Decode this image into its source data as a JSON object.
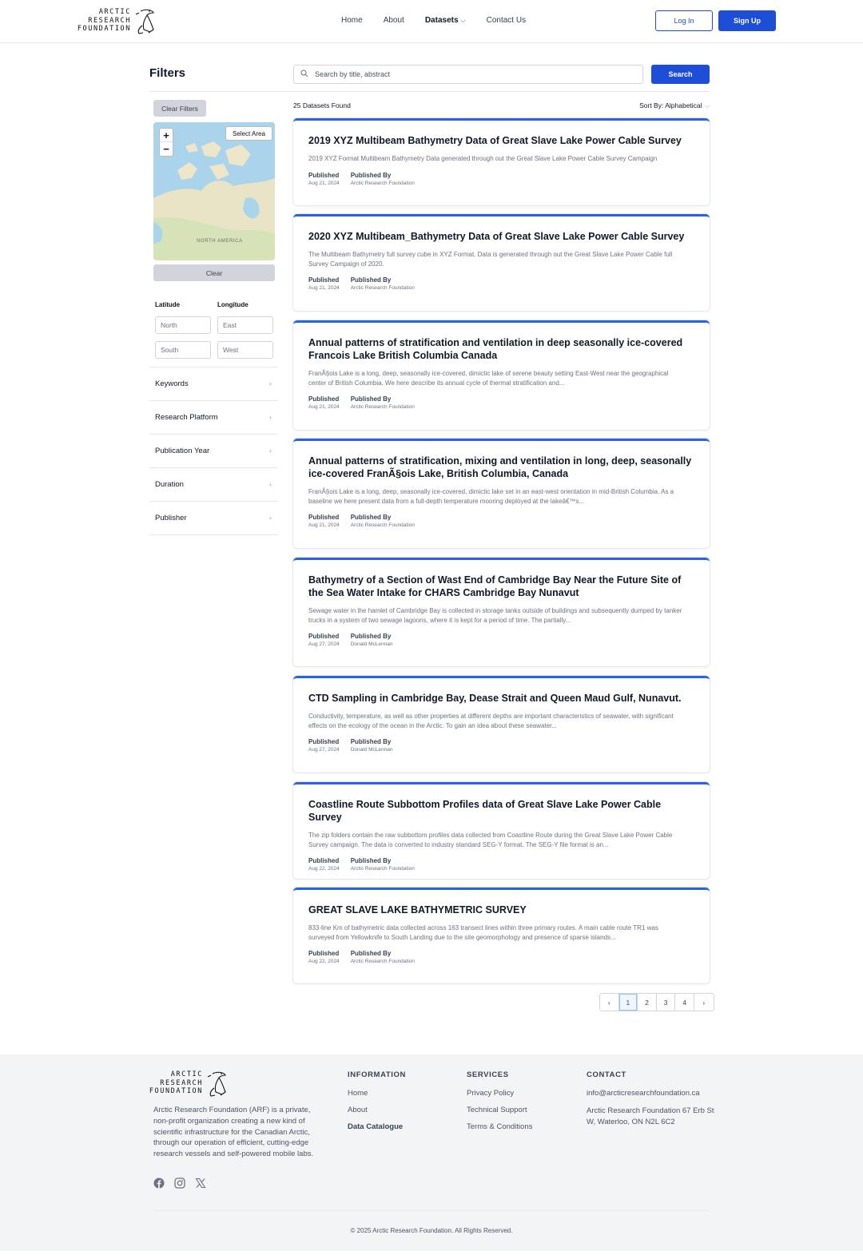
{
  "header": {
    "logo_lines": [
      "ARCTIC",
      "RESEARCH",
      "FOUNDATION"
    ],
    "nav": [
      {
        "label": "Home",
        "active": false
      },
      {
        "label": "About",
        "active": false
      },
      {
        "label": "Datasets",
        "active": true,
        "has_dropdown": true
      },
      {
        "label": "Contact Us",
        "active": false
      }
    ],
    "login_label": "Log In",
    "signup_label": "Sign Up"
  },
  "sidebar": {
    "title": "Filters",
    "clear_filters_label": "Clear Filters",
    "map": {
      "zoom_in": "+",
      "zoom_out": "−",
      "select_area_label": "Select Area",
      "region_label": "NORTH AMERICA",
      "clear_label": "Clear"
    },
    "latitude_label": "Latitude",
    "longitude_label": "Longitude",
    "north_placeholder": "North",
    "east_placeholder": "East",
    "south_placeholder": "South",
    "west_placeholder": "West",
    "accordions": [
      {
        "label": "Keywords",
        "icon": "+"
      },
      {
        "label": "Research Platform",
        "icon": "+"
      },
      {
        "label": "Publication Year",
        "icon": "+"
      },
      {
        "label": "Duration",
        "icon": "+"
      },
      {
        "label": "Publisher",
        "icon": "+"
      }
    ]
  },
  "main": {
    "search_placeholder": "Search by title, abstract",
    "search_button": "Search",
    "results_count": "25 Datasets Found",
    "sort_label": "Sort By: Alphabetical",
    "published_label": "Published",
    "published_by_label": "Published By",
    "datasets": [
      {
        "title": "2019 XYZ Multibeam Bathymetry Data of Great Slave Lake Power Cable Survey",
        "abstract": "2019 XYZ Format Multibeam Bathymetry Data generated through out the Great Slave Lake Power Cable Survey Campaign",
        "published": "Aug 21, 2024",
        "publisher": "Arctic Research Foundation"
      },
      {
        "title": "2020 XYZ Multibeam_Bathymetry Data of Great Slave Lake Power Cable Survey",
        "abstract": "The Multibeam Bathymetry full survey cube in XYZ Format. Data is generated through out the Great Slave Lake Power Cable full Survey Campaign of 2020.",
        "published": "Aug 21, 2024",
        "publisher": "Arctic Research Foundation"
      },
      {
        "title": "Annual patterns of stratification and ventilation in deep seasonally ice-covered Francois Lake British Columbia Canada",
        "abstract": "FranÃ§ois Lake is a long, deep, seasonally ice-covered, dimictic lake of serene beauty setting East-West near the geographical center of British Columbia. We here describe its annual cycle of thermal stratification and...",
        "published": "Aug 21, 2024",
        "publisher": "Arctic Research Foundation"
      },
      {
        "title": "Annual patterns of stratification, mixing and ventilation in long, deep, seasonally ice-covered FranÃ§ois Lake, British Columbia, Canada",
        "abstract": "FranÃ§ois Lake is a long, deep, seasonally ice-covered, dimictic lake set in an east-west orientation in mid-British Columbia. As a baseline we here present data from a full-depth temperature mooring deployed at the lakeâ€™s...",
        "published": "Aug 21, 2024",
        "publisher": "Arctic Research Foundation"
      },
      {
        "title": "Bathymetry of a Section of Wast End of Cambridge Bay Near the Future Site of the Sea Water Intake for CHARS Cambridge Bay Nunavut",
        "abstract": "Sewage water in the hamlet of Cambridge Bay is collected in storage tanks outside of buildings and subsequently dumped by tanker trucks in a system of two sewage lagoons, where it is kept for a period of time. The partially...",
        "published": "Aug 27, 2024",
        "publisher": "Donald McLennan"
      },
      {
        "title": "CTD Sampling in Cambridge Bay, Dease Strait and Queen Maud Gulf, Nunavut.",
        "abstract": "Conductivity, temperature, as well as other properties at different depths are important characteristics of seawater, with significant effects on the ecology of the ocean in the Arctic. To gain an idea about these seawater...",
        "published": "Aug 27, 2024",
        "publisher": "Donald McLennan"
      },
      {
        "title": "Coastline Route Subbottom Profiles data of Great Slave Lake Power Cable Survey",
        "abstract": "The zip folders contain the raw subbottom profiles data collected from Coastline Route during the Great Slave Lake Power Cable Survey campaign. The data is converted to industry standard SEG-Y format. The SEG-Y file format is an...",
        "published": "Aug 22, 2024",
        "publisher": "Arctic Research Foundation"
      },
      {
        "title": "GREAT SLAVE LAKE BATHYMETRIC SURVEY",
        "abstract": "833-line Km of bathymetric data collected across 163 transect lines within three primary routes. A main cable route TR1 was surveyed from Yellowknife to South Landing due to the site geomorphology and presence of sparse islands...",
        "published": "Aug 22, 2024",
        "publisher": "Arctic Research Foundation"
      }
    ],
    "pagination": {
      "prev": "‹",
      "pages": [
        "1",
        "2",
        "3",
        "4"
      ],
      "current": "1",
      "next": "›"
    }
  },
  "footer": {
    "description": "Arctic Research Foundation (ARF) is a private, non-profit organization creating a new kind of scientific infrastructure for the Canadian Arctic, through our operation of efficient, cutting-edge research vessels and self-powered mobile labs.",
    "social": [
      "facebook",
      "instagram",
      "x"
    ],
    "information": {
      "heading": "INFORMATION",
      "links": [
        "Home",
        "About",
        "Data Catalogue"
      ]
    },
    "services": {
      "heading": "SERVICES",
      "links": [
        "Privacy Policy",
        "Technical Support",
        "Terms & Conditions"
      ]
    },
    "contact": {
      "heading": "CONTACT",
      "email": "info@arcticresearchfoundation.ca",
      "address": "Arctic Research Foundation 67 Erb St W, Waterloo, ON N2L 6C2"
    },
    "copyright": "© 2025 Arctic Research Foundation. All Rights Reserved."
  },
  "colors": {
    "primary": "#1d4ed8",
    "card_accent": "#2563eb",
    "footer_bg": "#f3f4f6"
  }
}
